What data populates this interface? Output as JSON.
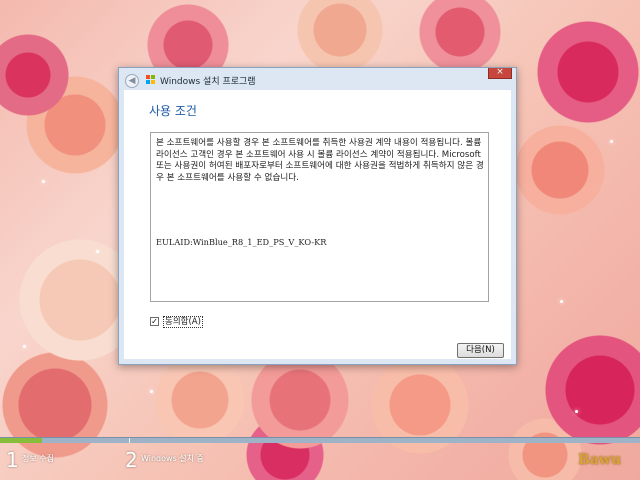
{
  "dialog": {
    "title": "Windows 설치 프로그램",
    "close_label": "×",
    "back_label": "◀",
    "heading": "사용 조건",
    "license_text": "본 소프트웨어를 사용할 경우 본 소프트웨어를 취득한 사용권 계약 내용이 적용됩니다. 볼륨 라이선스 고객인 경우 본 소프트웨어 사용 시 볼륨 라이선스 계약이 적용됩니다. Microsoft 또는 사용권이 허여된 배포자로부터 소프트웨어에 대한 사용권을 적법하게 취득하지 않은 경우 본 소프트웨어를 사용할 수 없습니다.",
    "eula_id": "EULAID:WinBlue_R8_1_ED_PS_V_KO-KR",
    "accept_checked": true,
    "checkbox_mark": "✓",
    "accept_label": "동의함(A)",
    "next_label": "다음(N)"
  },
  "progress": {
    "steps": [
      {
        "number": "1",
        "label": "정보 수집"
      },
      {
        "number": "2",
        "label": "Windows 설치 중"
      }
    ],
    "completed_fraction": 0.065
  },
  "watermark": "Bawu",
  "colors": {
    "heading": "#1e5aa8",
    "progress_done": "#86bd3a",
    "progress_track": "#9fb3c8",
    "close_button": "#c7473c",
    "watermark": "#d8a23a"
  },
  "icons": [
    "back-arrow-icon",
    "windows-logo-icon",
    "close-icon",
    "checkmark-icon"
  ]
}
